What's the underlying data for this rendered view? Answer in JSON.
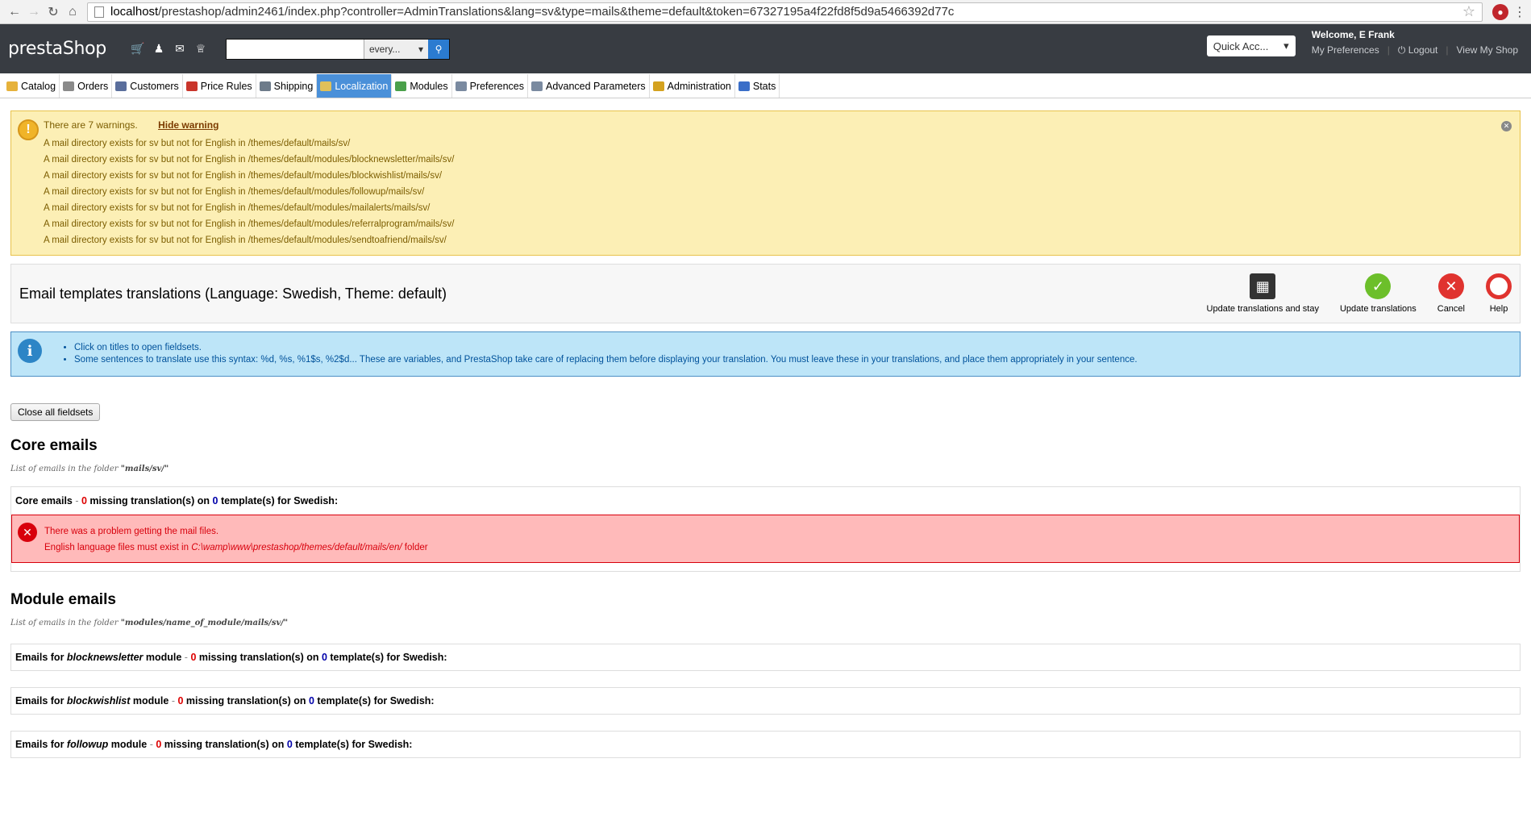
{
  "browser": {
    "url_host": "localhost",
    "url_path": "/prestashop/admin2461/index.php?controller=AdminTranslations&lang=sv&type=mails&theme=default&token=67327195a4f22fd8f5d9a5466392d77c"
  },
  "header": {
    "logo": "prestaShop",
    "search_placeholder": "",
    "search_scope": "every...",
    "quick_access": "Quick Acc...",
    "welcome": "Welcome, E Frank",
    "links": {
      "preferences": "My Preferences",
      "logout": "Logout",
      "view_shop": "View My Shop"
    }
  },
  "tabs": [
    {
      "label": "Catalog",
      "icon_color": "#e6b23b"
    },
    {
      "label": "Orders",
      "icon_color": "#8a8a8a"
    },
    {
      "label": "Customers",
      "icon_color": "#5a6e9c"
    },
    {
      "label": "Price Rules",
      "icon_color": "#c9352b"
    },
    {
      "label": "Shipping",
      "icon_color": "#6d7b8a"
    },
    {
      "label": "Localization",
      "icon_color": "#e0c05a"
    },
    {
      "label": "Modules",
      "icon_color": "#4aa04a"
    },
    {
      "label": "Preferences",
      "icon_color": "#7a8aa0"
    },
    {
      "label": "Advanced Parameters",
      "icon_color": "#7a8aa0"
    },
    {
      "label": "Administration",
      "icon_color": "#d4a21f"
    },
    {
      "label": "Stats",
      "icon_color": "#3a6ec8"
    }
  ],
  "active_tab": "Localization",
  "warning": {
    "title": "There are 7 warnings.",
    "hide_label": "Hide warning",
    "lines": [
      "A mail directory exists for sv but not for English in /themes/default/mails/sv/",
      "A mail directory exists for sv but not for English in /themes/default/modules/blocknewsletter/mails/sv/",
      "A mail directory exists for sv but not for English in /themes/default/modules/blockwishlist/mails/sv/",
      "A mail directory exists for sv but not for English in /themes/default/modules/followup/mails/sv/",
      "A mail directory exists for sv but not for English in /themes/default/modules/mailalerts/mails/sv/",
      "A mail directory exists for sv but not for English in /themes/default/modules/referralprogram/mails/sv/",
      "A mail directory exists for sv but not for English in /themes/default/modules/sendtoafriend/mails/sv/"
    ]
  },
  "toolbar": {
    "title": "Email templates translations (Language: Swedish, Theme: default)",
    "actions": {
      "update_stay": "Update translations and stay",
      "update": "Update translations",
      "cancel": "Cancel",
      "help": "Help"
    }
  },
  "info": {
    "lines": [
      "Click on titles to open fieldsets.",
      "Some sentences to translate use this syntax: %d, %s, %1$s, %2$d... These are variables, and PrestaShop take care of replacing them before displaying your translation. You must leave these in your translations, and place them appropriately in your sentence."
    ]
  },
  "close_all": "Close all fieldsets",
  "core": {
    "title": "Core emails",
    "subtitle_prefix": "List of emails in the folder ",
    "subtitle_folder": "\"mails/sv/\"",
    "fieldset_label": "Core emails",
    "missing": "0",
    "templates": "0",
    "language": "Swedish",
    "error_title": "There was a problem getting the mail files.",
    "error_prefix": "English language files must exist in ",
    "error_path": "C:\\wamp\\www\\prestashop/themes/default/mails/en/",
    "error_suffix": " folder"
  },
  "module": {
    "title": "Module emails",
    "subtitle_prefix": "List of emails in the folder ",
    "subtitle_folder": "\"modules/name_of_module/mails/sv/\"",
    "items": [
      {
        "name": "blocknewsletter",
        "missing": "0",
        "templates": "0"
      },
      {
        "name": "blockwishlist",
        "missing": "0",
        "templates": "0"
      },
      {
        "name": "followup",
        "missing": "0",
        "templates": "0"
      }
    ]
  },
  "labels": {
    "dash": " - ",
    "missing_text": " missing translation(s) on ",
    "template_text": " template(s) for ",
    "emails_for": "Emails for ",
    "module_word": " module",
    "colon": ":"
  }
}
